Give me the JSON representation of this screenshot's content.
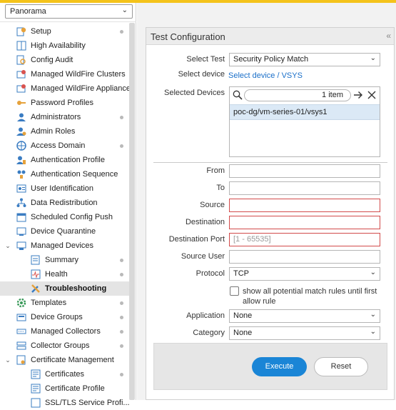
{
  "context_selector": {
    "value": "Panorama"
  },
  "nav": [
    {
      "label": "Setup",
      "dot": true
    },
    {
      "label": "High Availability",
      "dot": false
    },
    {
      "label": "Config Audit",
      "dot": false
    },
    {
      "label": "Managed WildFire Clusters",
      "dot": false
    },
    {
      "label": "Managed WildFire Appliances",
      "dot": false
    },
    {
      "label": "Password Profiles",
      "dot": false
    },
    {
      "label": "Administrators",
      "dot": true
    },
    {
      "label": "Admin Roles",
      "dot": false
    },
    {
      "label": "Access Domain",
      "dot": true
    },
    {
      "label": "Authentication Profile",
      "dot": false
    },
    {
      "label": "Authentication Sequence",
      "dot": false
    },
    {
      "label": "User Identification",
      "dot": false
    },
    {
      "label": "Data Redistribution",
      "dot": false
    },
    {
      "label": "Scheduled Config Push",
      "dot": false
    },
    {
      "label": "Device Quarantine",
      "dot": false
    },
    {
      "label": "Managed Devices",
      "dot": false
    },
    {
      "label": "Summary",
      "dot": true
    },
    {
      "label": "Health",
      "dot": true
    },
    {
      "label": "Troubleshooting",
      "dot": false
    },
    {
      "label": "Templates",
      "dot": true
    },
    {
      "label": "Device Groups",
      "dot": true
    },
    {
      "label": "Managed Collectors",
      "dot": true
    },
    {
      "label": "Collector Groups",
      "dot": true
    },
    {
      "label": "Certificate Management",
      "dot": false
    },
    {
      "label": "Certificates",
      "dot": true
    },
    {
      "label": "Certificate Profile",
      "dot": false
    },
    {
      "label": "SSL/TLS Service Profi...",
      "dot": false
    }
  ],
  "panel": {
    "title": "Test Configuration",
    "collapse_icon": "«",
    "select_test": {
      "label": "Select Test",
      "value": "Security Policy Match"
    },
    "select_device": {
      "label": "Select device",
      "link": "Select device / VSYS"
    },
    "selected_devices": {
      "label": "Selected Devices",
      "count": "1 item",
      "items": [
        "poc-dg/vm-series-01/vsys1"
      ]
    },
    "fields": {
      "from": {
        "label": "From",
        "value": ""
      },
      "to": {
        "label": "To",
        "value": ""
      },
      "source": {
        "label": "Source",
        "value": ""
      },
      "destination": {
        "label": "Destination",
        "value": ""
      },
      "destination_port": {
        "label": "Destination Port",
        "placeholder": "[1 - 65535]"
      },
      "source_user": {
        "label": "Source User",
        "value": ""
      },
      "protocol": {
        "label": "Protocol",
        "value": "TCP"
      },
      "show_all": {
        "label": "show all potential match rules until first allow rule",
        "checked": false
      },
      "application": {
        "label": "Application",
        "value": "None"
      },
      "category": {
        "label": "Category",
        "value": "None"
      }
    },
    "buttons": {
      "execute": "Execute",
      "reset": "Reset"
    }
  }
}
